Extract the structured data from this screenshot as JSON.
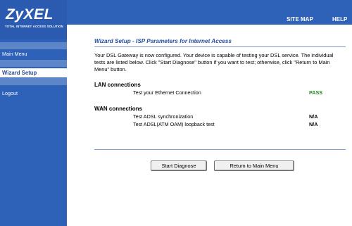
{
  "brand": {
    "name": "ZyXEL",
    "tagline": "TOTAL INTERNET ACCESS SOLUTION"
  },
  "topnav": {
    "site_map": "SITE MAP",
    "help": "HELP"
  },
  "sidebar": {
    "items": [
      {
        "label": "Main Menu"
      },
      {
        "label": "Wizard Setup"
      },
      {
        "label": "Logout"
      }
    ]
  },
  "content": {
    "title": "Wizard Setup - ISP Parameters for Internet Access",
    "intro": "Your DSL Gateway is now configured. Your device is capable of testing your DSL service. The individual tests are listed below. Click \"Start Diagnose\" button if you want to test; otherwise, click \"Return to Main Menu\" button.",
    "lan": {
      "heading": "LAN connections",
      "tests": [
        {
          "label": "Test your Ethernet Connection",
          "result": "PASS"
        }
      ]
    },
    "wan": {
      "heading": "WAN connections",
      "tests": [
        {
          "label": "Test ADSL synchronization",
          "result": "N/A"
        },
        {
          "label": "Test ADSL(ATM OAM) loopback test",
          "result": "N/A"
        }
      ]
    }
  },
  "buttons": {
    "start": "Start Diagnose",
    "return": "Return to Main Menu"
  },
  "colors": {
    "primary": "#2d62b8",
    "title": "#2550a2",
    "pass": "#1f8a1f"
  }
}
